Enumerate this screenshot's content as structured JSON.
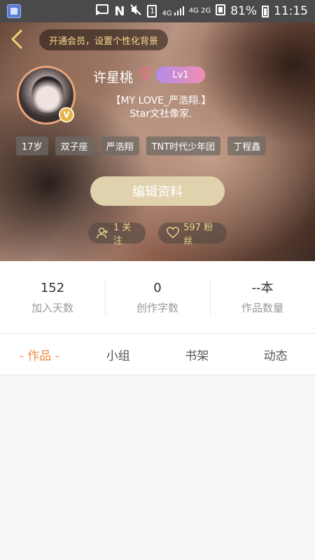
{
  "status_bar": {
    "network": "N",
    "signal_1": "4G",
    "signal_2": "4G 2G",
    "battery": "81%",
    "time": "11:15",
    "sim_label": "1",
    "icons": [
      "app-icon",
      "cast-icon",
      "nfc-icon",
      "mute-icon",
      "sim-icon",
      "signal-icon",
      "battery-icon"
    ]
  },
  "header": {
    "vip_prompt": "开通会员，设置个性化背景",
    "username": "许星桃",
    "gender_symbol": "♀",
    "level": "Lv1",
    "verified_badge": "V",
    "bio_line_1": "【MY LOVE_严浩翔.】",
    "bio_line_2": "Star文社像家.",
    "tags": [
      "17岁",
      "双子座",
      "严浩翔",
      "TNT时代少年团",
      "丁程鑫"
    ],
    "edit_button": "编辑资料",
    "follow": "1 关注",
    "fans": "597 粉丝"
  },
  "stats": [
    {
      "value": "152",
      "label": "加入天数"
    },
    {
      "value": "0",
      "label": "创作字数"
    },
    {
      "value": "--本",
      "label": "作品数量"
    }
  ],
  "tabs": [
    {
      "label": "- 作品 -",
      "active": true
    },
    {
      "label": "小组",
      "active": false
    },
    {
      "label": "书架",
      "active": false
    },
    {
      "label": "动态",
      "active": false
    }
  ],
  "colors": {
    "accent": "#f08a45",
    "tag_bg": "#6e6964",
    "edit_button_bg": "#e0d2ad",
    "level_gradient_start": "#b68ae8",
    "level_gradient_end": "#f08fb0"
  }
}
